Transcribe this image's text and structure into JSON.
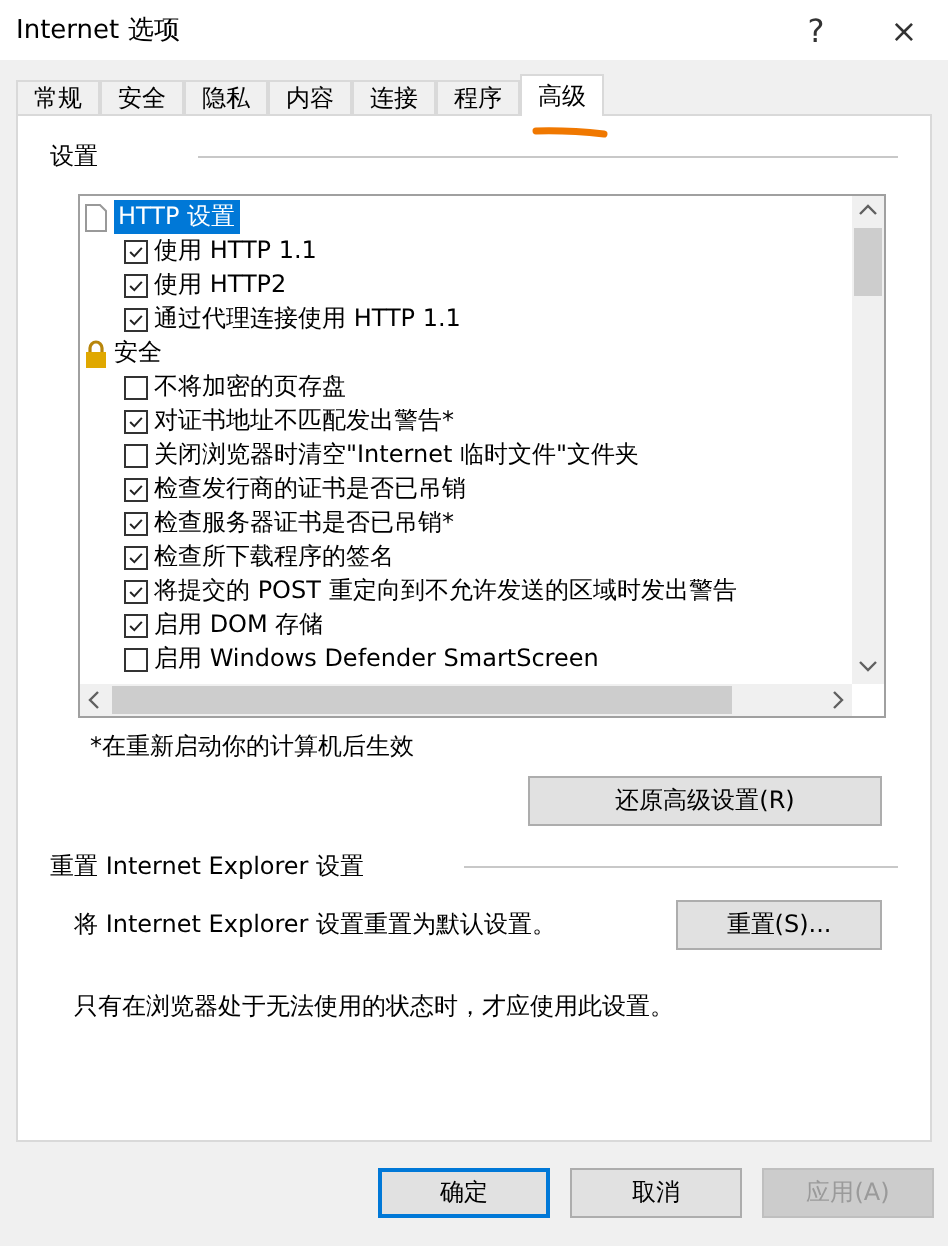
{
  "window": {
    "title": "Internet 选项",
    "help": "?",
    "close": "×"
  },
  "tabs": [
    {
      "label": "常规",
      "selected": false
    },
    {
      "label": "安全",
      "selected": false
    },
    {
      "label": "隐私",
      "selected": false
    },
    {
      "label": "内容",
      "selected": false
    },
    {
      "label": "连接",
      "selected": false
    },
    {
      "label": "程序",
      "selected": false
    },
    {
      "label": "高级",
      "selected": true
    }
  ],
  "settings": {
    "label": "设置",
    "items": [
      {
        "kind": "page",
        "label": "HTTP 设置",
        "selected": true
      },
      {
        "kind": "checkbox",
        "label": "使用 HTTP 1.1",
        "checked": true
      },
      {
        "kind": "checkbox",
        "label": "使用 HTTP2",
        "checked": true
      },
      {
        "kind": "checkbox",
        "label": "通过代理连接使用 HTTP 1.1",
        "checked": true
      },
      {
        "kind": "lock",
        "label": "安全",
        "selected": false
      },
      {
        "kind": "checkbox",
        "label": "不将加密的页存盘",
        "checked": false
      },
      {
        "kind": "checkbox",
        "label": "对证书地址不匹配发出警告*",
        "checked": true
      },
      {
        "kind": "checkbox",
        "label": "关闭浏览器时清空\"Internet 临时文件\"文件夹",
        "checked": false
      },
      {
        "kind": "checkbox",
        "label": "检查发行商的证书是否已吊销",
        "checked": true
      },
      {
        "kind": "checkbox",
        "label": "检查服务器证书是否已吊销*",
        "checked": true
      },
      {
        "kind": "checkbox",
        "label": "检查所下载程序的签名",
        "checked": true
      },
      {
        "kind": "checkbox",
        "label": "将提交的 POST 重定向到不允许发送的区域时发出警告",
        "checked": true
      },
      {
        "kind": "checkbox",
        "label": "启用 DOM 存储",
        "checked": true
      },
      {
        "kind": "checkbox",
        "label": "启用 Windows Defender SmartScreen",
        "checked": false
      }
    ],
    "footnote": "*在重新启动你的计算机后生效",
    "restore_button": "还原高级设置(R)"
  },
  "reset": {
    "label": "重置 Internet Explorer 设置",
    "description": "将 Internet Explorer 设置重置为默认设置。",
    "button": "重置(S)...",
    "note": "只有在浏览器处于无法使用的状态时，才应使用此设置。"
  },
  "buttons": [
    {
      "label": "确定",
      "disabled": false,
      "default": true
    },
    {
      "label": "取消",
      "disabled": false,
      "default": false
    },
    {
      "label": "应用(A)",
      "disabled": true,
      "default": false
    }
  ]
}
